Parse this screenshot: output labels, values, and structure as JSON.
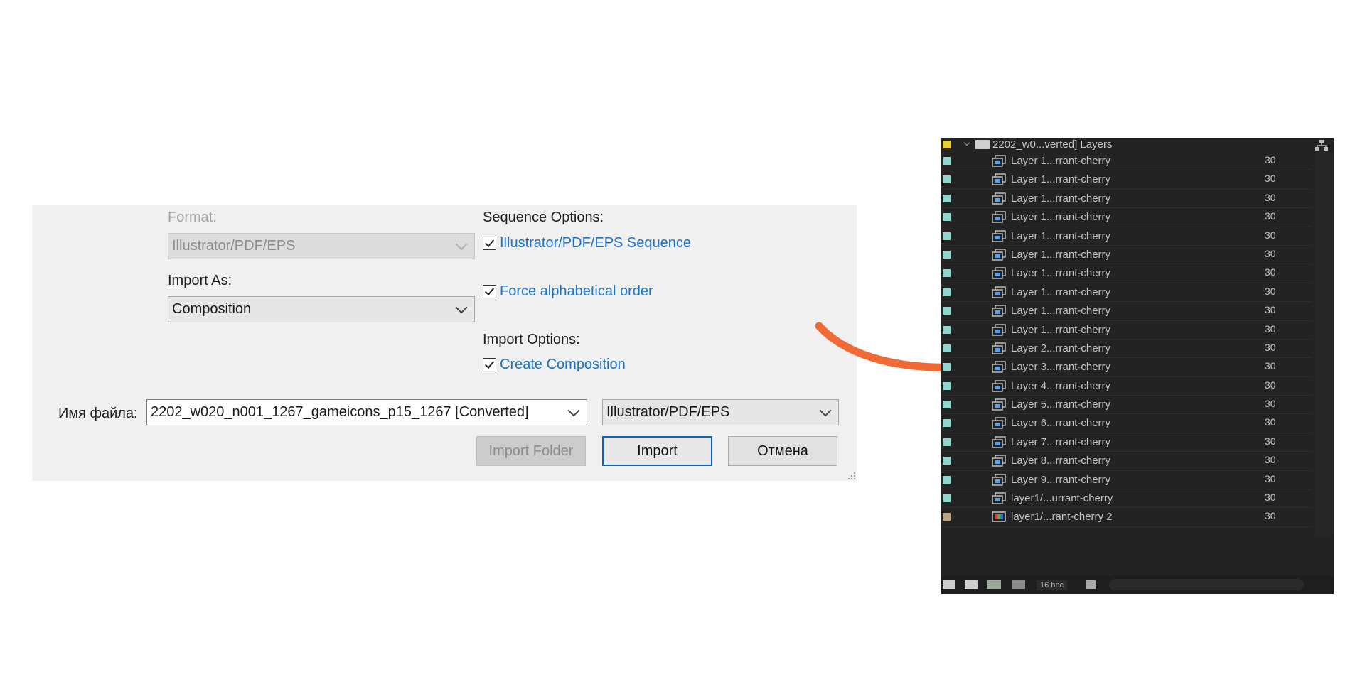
{
  "dialog": {
    "format_label": "Format:",
    "format_value": "Illustrator/PDF/EPS",
    "import_as_label": "Import As:",
    "import_as_value": "Composition",
    "sequence_options_label": "Sequence Options:",
    "sequence_checkbox": "Illustrator/PDF/EPS Sequence",
    "force_alpha_checkbox": "Force alphabetical order",
    "import_options_label": "Import Options:",
    "create_comp_checkbox": "Create Composition",
    "filename_label": "Имя файла:",
    "filename_value": "2202_w020_n001_1267_gameicons_p15_1267 [Converted]",
    "filetype_value": "Illustrator/PDF/EPS",
    "import_folder_button": "Import Folder",
    "import_button": "Import",
    "cancel_button": "Отмена"
  },
  "colors": {
    "accent_link": "#1a73c8",
    "arrow": "#f06a36",
    "folder_swatch": "#e6d03a",
    "comp_swatch": "#8fd6d0",
    "footage_swatch": "#b8a584"
  },
  "panel": {
    "folder_name": "2202_w0...verted] Layers",
    "items": [
      {
        "name": "Layer 1...rrant-cherry",
        "fps": "30",
        "icon": "composition-icon"
      },
      {
        "name": "Layer 1...rrant-cherry",
        "fps": "30",
        "icon": "composition-icon"
      },
      {
        "name": "Layer 1...rrant-cherry",
        "fps": "30",
        "icon": "composition-icon"
      },
      {
        "name": "Layer 1...rrant-cherry",
        "fps": "30",
        "icon": "composition-icon"
      },
      {
        "name": "Layer 1...rrant-cherry",
        "fps": "30",
        "icon": "composition-icon"
      },
      {
        "name": "Layer 1...rrant-cherry",
        "fps": "30",
        "icon": "composition-icon"
      },
      {
        "name": "Layer 1...rrant-cherry",
        "fps": "30",
        "icon": "composition-icon"
      },
      {
        "name": "Layer 1...rrant-cherry",
        "fps": "30",
        "icon": "composition-icon"
      },
      {
        "name": "Layer 1...rrant-cherry",
        "fps": "30",
        "icon": "composition-icon"
      },
      {
        "name": "Layer 1...rrant-cherry",
        "fps": "30",
        "icon": "composition-icon"
      },
      {
        "name": "Layer 2...rrant-cherry",
        "fps": "30",
        "icon": "composition-icon"
      },
      {
        "name": "Layer 3...rrant-cherry",
        "fps": "30",
        "icon": "composition-icon"
      },
      {
        "name": "Layer 4...rrant-cherry",
        "fps": "30",
        "icon": "composition-icon"
      },
      {
        "name": "Layer 5...rrant-cherry",
        "fps": "30",
        "icon": "composition-icon"
      },
      {
        "name": "Layer 6...rrant-cherry",
        "fps": "30",
        "icon": "composition-icon"
      },
      {
        "name": "Layer 7...rrant-cherry",
        "fps": "30",
        "icon": "composition-icon"
      },
      {
        "name": "Layer 8...rrant-cherry",
        "fps": "30",
        "icon": "composition-icon"
      },
      {
        "name": "Layer 9...rrant-cherry",
        "fps": "30",
        "icon": "composition-icon"
      },
      {
        "name": "layer1/...urrant-cherry",
        "fps": "30",
        "icon": "composition-icon"
      },
      {
        "name": "layer1/...rant-cherry 2",
        "fps": "30",
        "icon": "footage-icon"
      }
    ],
    "footer_bpc": "16 bpc"
  }
}
